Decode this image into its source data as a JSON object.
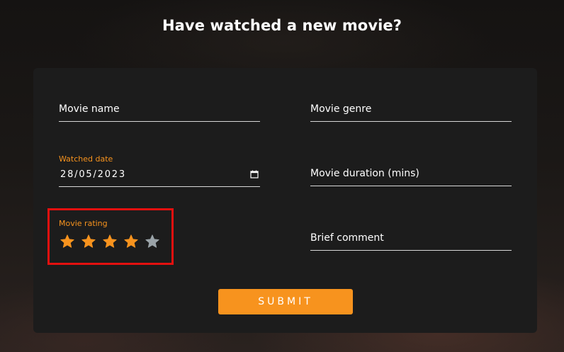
{
  "header": {
    "title": "Have watched a new movie?"
  },
  "form": {
    "movie_name_label": "Movie name",
    "movie_genre_label": "Movie genre",
    "watched_date_label": "Watched date",
    "watched_date_value": "28/05/2023",
    "movie_duration_label": "Movie duration (mins)",
    "movie_rating_label": "Movie rating",
    "brief_comment_label": "Brief comment",
    "submit_label": "SUBMIT"
  },
  "rating": {
    "value": 4,
    "max": 5,
    "filled_color": "#f7931e",
    "empty_color": "#9aa3a8"
  },
  "colors": {
    "accent": "#f7931e",
    "highlight_border": "#e3100f",
    "card_background": "#1c1c1c"
  },
  "icons": {
    "date_picker": "calendar-icon",
    "rating": "star-icon"
  }
}
